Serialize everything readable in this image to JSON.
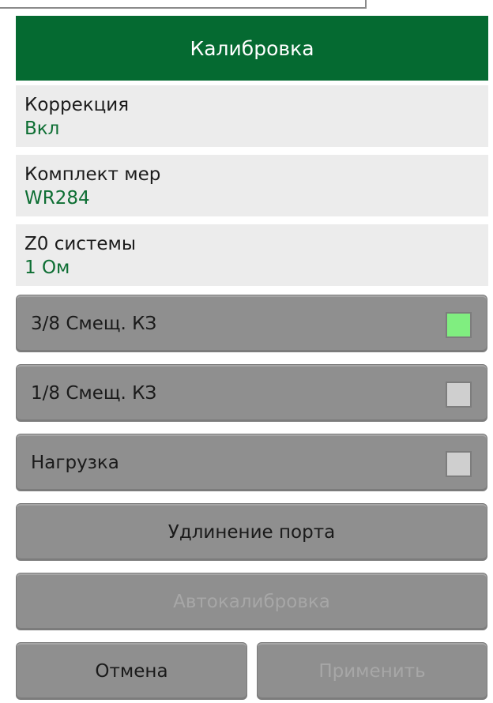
{
  "header": {
    "title": "Калибровка"
  },
  "correction": {
    "label": "Коррекция",
    "value": "Вкл"
  },
  "cal_kit": {
    "label": "Комплект мер",
    "value": "WR284"
  },
  "system_z0": {
    "label": "Z0 системы",
    "value": "1 Ом"
  },
  "standards": [
    {
      "label": "3/8 Смещ. КЗ",
      "indicator_color": "#80ee80",
      "measured": true
    },
    {
      "label": "1/8 Смещ. КЗ",
      "indicator_color": "#cfcfcf",
      "measured": false
    },
    {
      "label": "Нагрузка",
      "indicator_color": "#cfcfcf",
      "measured": false
    }
  ],
  "port_extension": {
    "label": "Удлинение порта"
  },
  "autocal": {
    "label": "Автокалибровка",
    "enabled": false
  },
  "footer": {
    "cancel_label": "Отмена",
    "apply_label": "Применить",
    "apply_enabled": false
  },
  "colors": {
    "title_bg": "#056a31",
    "value_text": "#0d6e33",
    "info_bg": "#ececec",
    "button_bg": "#8f8f8f",
    "disabled_text": "#a7a7a7"
  }
}
